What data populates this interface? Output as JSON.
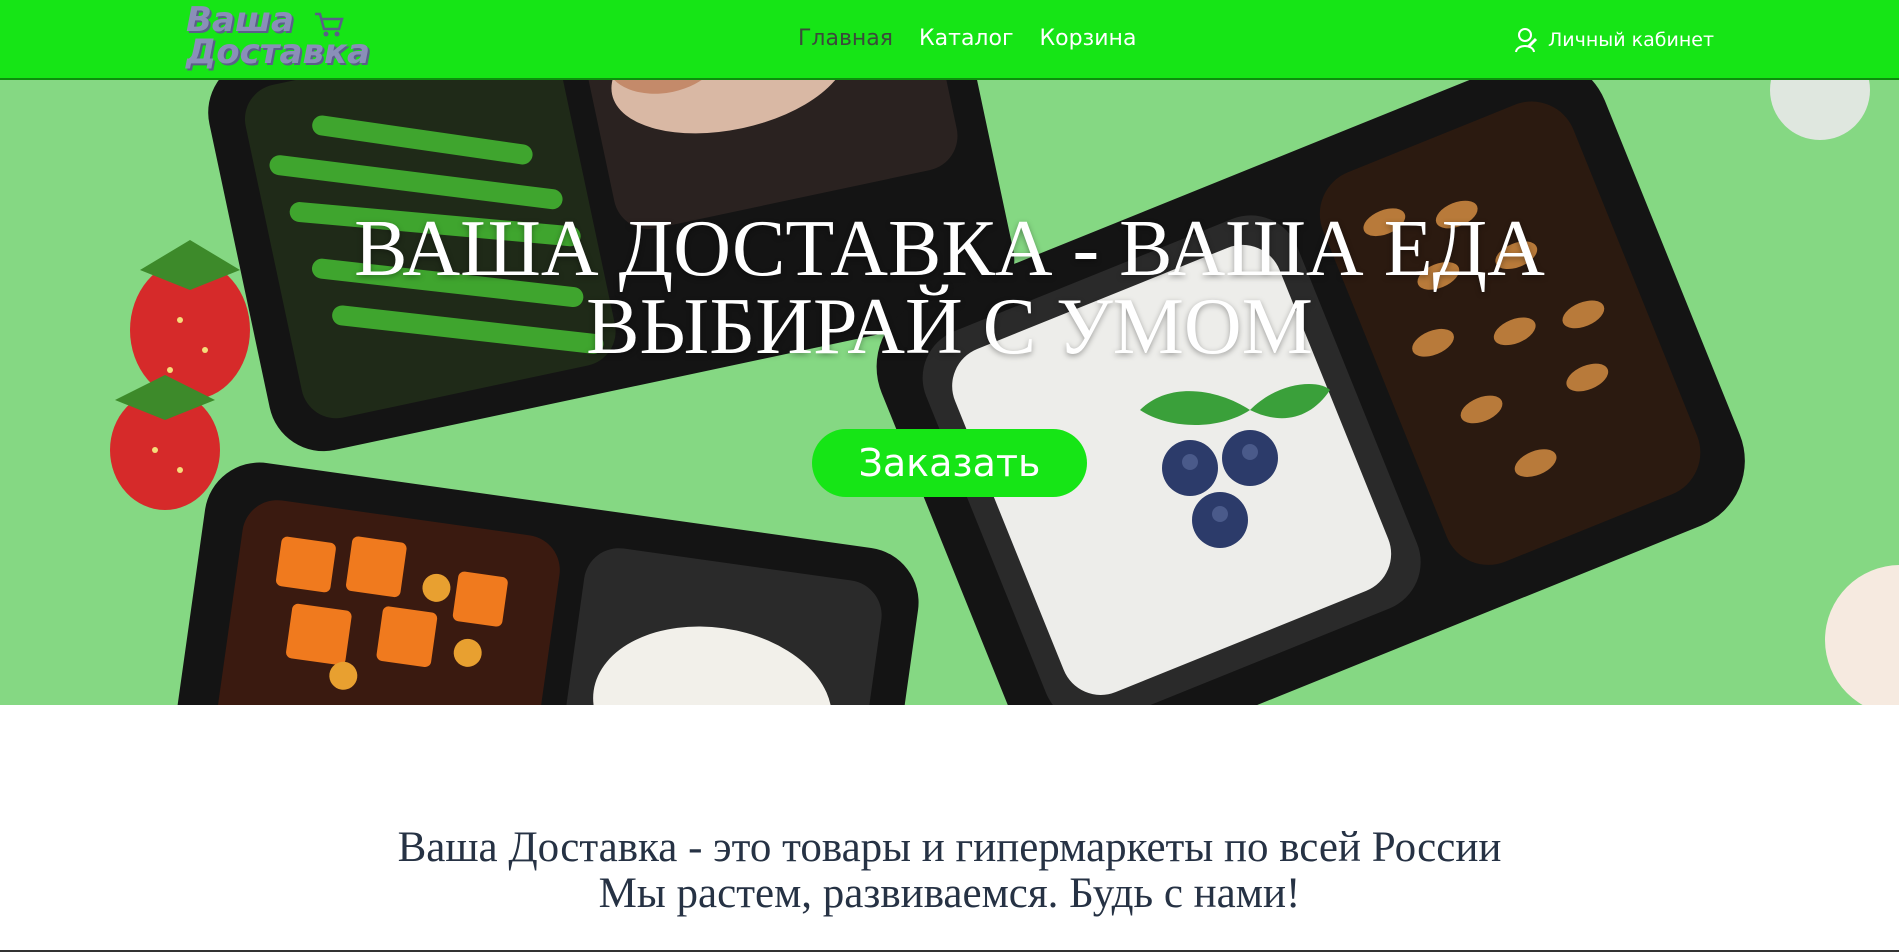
{
  "logo": {
    "line1": "Ваша",
    "line2": "Доставка"
  },
  "nav": {
    "home": "Главная",
    "catalog": "Каталог",
    "cart": "Корзина"
  },
  "account": {
    "label": "Личный кабинет"
  },
  "hero": {
    "title_line1": "ВАША ДОСТАВКА - ВАША ЕДА",
    "title_line2": "ВЫБИРАЙ С УМОМ",
    "order_button": "Заказать"
  },
  "about": {
    "line1": "Ваша Доставка - это товары и гипермаркеты по всей России",
    "line2": "Мы растем, развиваемся. Будь с нами!"
  },
  "colors": {
    "accent": "#16e516",
    "hero_bg": "#7fd67f",
    "text_dark": "#263244"
  },
  "icons": {
    "cart": "cart-icon",
    "user": "user-icon"
  }
}
